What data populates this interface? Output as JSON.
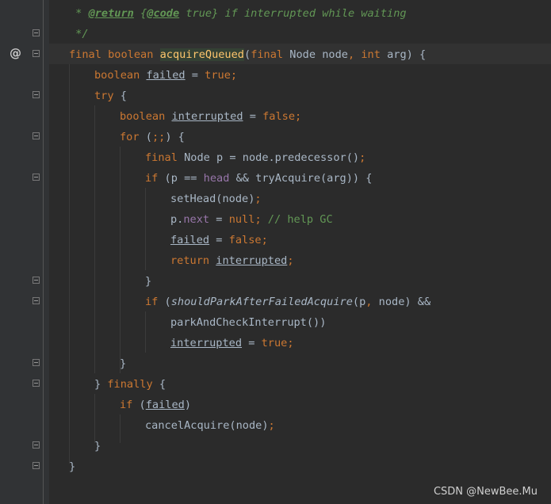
{
  "code": {
    "l1": {
      "star": " * ",
      "tag1": "@return",
      "brace_open": " {",
      "tag2": "@code",
      "rest": " true} if interrupted while waiting"
    },
    "l2": " */",
    "l3": {
      "final": "final",
      "boolean": "boolean",
      "method": "acquireQueued",
      "paren": "(",
      "final2": "final",
      "node_type": " Node node",
      "comma": ", ",
      "int": "int",
      "arg": " arg) {"
    },
    "l4": {
      "boolean": "boolean",
      "failed": "failed",
      "eq": " = ",
      "true": "true",
      "semi": ";"
    },
    "l5": {
      "try": "try",
      "brace": " {"
    },
    "l6": {
      "boolean": "boolean",
      "interrupted": "interrupted",
      "eq": " = ",
      "false": "false",
      "semi": ";"
    },
    "l7": {
      "for": "for",
      "cond": " (",
      "semis": ";;",
      "close": ") {"
    },
    "l8": {
      "final": "final",
      "rest": " Node p = node.predecessor()",
      "semi": ";"
    },
    "l9": {
      "if": "if",
      "open": " (p == ",
      "head": "head",
      "rest": " && tryAcquire(arg)) {"
    },
    "l10": {
      "call": "setHead(node)",
      "semi": ";"
    },
    "l11": {
      "p": "p.",
      "next": "next",
      "eq": " = ",
      "null": "null",
      "semi": ";",
      "comment": " // help GC"
    },
    "l12": {
      "failed": "failed",
      "eq": " = ",
      "false": "false",
      "semi": ";"
    },
    "l13": {
      "return": "return",
      "interrupted": "interrupted",
      "semi": ";"
    },
    "l14": "}",
    "l15": {
      "if": "if",
      "open": " (",
      "method": "shouldParkAfterFailedAcquire",
      "args": "(p",
      "comma": ", ",
      "rest": "node) &&"
    },
    "l16": "parkAndCheckInterrupt())",
    "l17": {
      "interrupted": "interrupted",
      "eq": " = ",
      "true": "true",
      "semi": ";"
    },
    "l18": "}",
    "l19": {
      "close": "} ",
      "finally": "finally",
      "brace": " {"
    },
    "l20": {
      "if": "if",
      "open": " (",
      "failed": "failed",
      "close": ")"
    },
    "l21": {
      "call": "cancelAcquire(node)",
      "semi": ";"
    },
    "l22": "}",
    "l23": "}"
  },
  "gutter": {
    "override_icon": "@"
  },
  "watermark": "CSDN @NewBee.Mu",
  "colors": {
    "keyword": "#cc7832",
    "method": "#ffc66d",
    "field": "#9876aa",
    "comment": "#629755",
    "text": "#a9b7c6",
    "background": "#2b2b2b"
  }
}
